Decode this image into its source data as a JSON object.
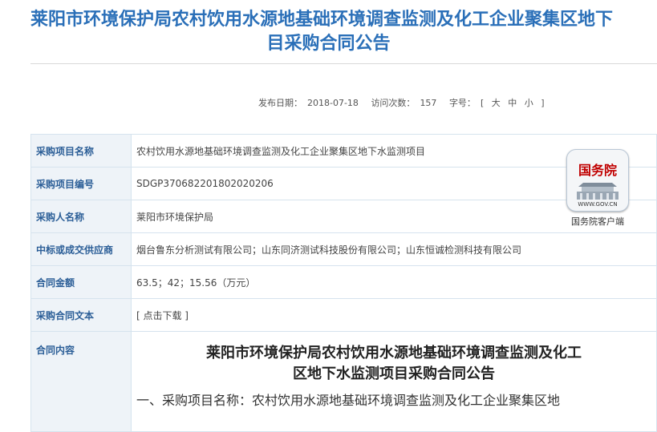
{
  "page": {
    "title_line1": "莱阳市环境保护局农村饮用水源地基础环境调查监测及化工企业聚集区地下",
    "title_line2": "目采购合同公告"
  },
  "meta": {
    "publish_label": "发布日期：",
    "publish_date": "2018-07-18",
    "views_label": "访问次数：",
    "views": "157",
    "font_label": "字号：",
    "open_bracket": "[",
    "size_large": "大",
    "size_medium": "中",
    "size_small": "小",
    "close_bracket": "]"
  },
  "rows": [
    {
      "label": "采购项目名称",
      "value": "农村饮用水源地基础环境调查监测及化工企业聚集区地下水监测项目"
    },
    {
      "label": "采购项目编号",
      "value": "SDGP370682201802020206"
    },
    {
      "label": "采购人名称",
      "value": "莱阳市环境保护局"
    },
    {
      "label": "中标或成交供应商",
      "value": "烟台鲁东分析测试有限公司；山东同济测试科技股份有限公司；山东恒诚检测科技有限公司"
    },
    {
      "label": "合同金额",
      "value": "63.5；42；15.56（万元）"
    },
    {
      "label": "采购合同文本",
      "value": "[ 点击下载 ]"
    },
    {
      "label": "合同内容",
      "value": ""
    }
  ],
  "contract": {
    "title_line1": "莱阳市环境保护局农村饮用水源地基础环境调查监测及化工",
    "title_line2": "区地下水监测项目采购合同公告",
    "para1": "一、采购项目名称：农村饮用水源地基础环境调查监测及化工企业聚集区地"
  },
  "badge": {
    "name": "国务院",
    "url": "WWW.GOV.CN",
    "caption": "国务院客户端"
  },
  "colors": {
    "title_blue": "#2a6fb8",
    "label_bg": "#eef3f8",
    "label_text": "#2b5e97",
    "badge_red": "#c00000"
  }
}
